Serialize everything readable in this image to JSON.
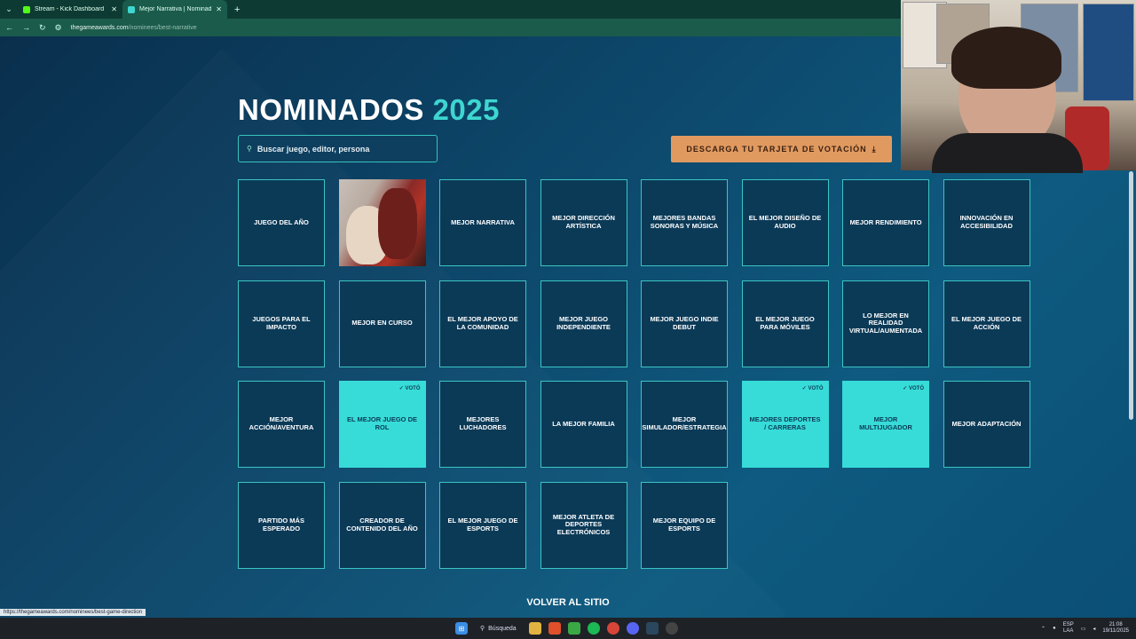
{
  "browser": {
    "tabs": [
      {
        "title": "Stream - Kick Dashboard",
        "favicon_color": "#53fc18",
        "active": false
      },
      {
        "title": "Mejor Narrativa | Nominados |",
        "favicon_color": "#3ed6d0",
        "active": true
      }
    ],
    "url_host": "thegameawards.com",
    "url_path": "/nominees/best-narrative"
  },
  "page": {
    "heading_main": "NOMINADOS",
    "heading_year": "2025",
    "search_placeholder": "Buscar juego, editor, persona",
    "download_label": "DESCARGA TU TARJETA DE VOTACIÓN",
    "back_label": "VOLVER AL SITIO",
    "status_url": "https://thegameawards.com/nominees/best-game-direction",
    "voted_label": "✓ VOTÓ",
    "accent_color": "#3ed6d0",
    "button_color": "#e09a60"
  },
  "categories": [
    {
      "label": "JUEGO DEL AÑO",
      "voted": false
    },
    {
      "label": "",
      "voted": false,
      "image": true
    },
    {
      "label": "MEJOR NARRATIVA",
      "voted": false
    },
    {
      "label": "MEJOR DIRECCIÓN ARTÍSTICA",
      "voted": false
    },
    {
      "label": "MEJORES BANDAS SONORAS Y MÚSICA",
      "voted": false
    },
    {
      "label": "EL MEJOR DISEÑO DE AUDIO",
      "voted": false
    },
    {
      "label": "MEJOR RENDIMIENTO",
      "voted": false
    },
    {
      "label": "INNOVACIÓN EN ACCESIBILIDAD",
      "voted": false
    },
    {
      "label": "JUEGOS PARA EL IMPACTO",
      "voted": false
    },
    {
      "label": "MEJOR EN CURSO",
      "voted": false
    },
    {
      "label": "EL MEJOR APOYO DE LA COMUNIDAD",
      "voted": false
    },
    {
      "label": "MEJOR JUEGO INDEPENDIENTE",
      "voted": false
    },
    {
      "label": "MEJOR JUEGO INDIE DEBUT",
      "voted": false
    },
    {
      "label": "EL MEJOR JUEGO PARA MÓVILES",
      "voted": false
    },
    {
      "label": "LO MEJOR EN REALIDAD VIRTUAL/AUMENTADA",
      "voted": false
    },
    {
      "label": "EL MEJOR JUEGO DE ACCIÓN",
      "voted": false
    },
    {
      "label": "MEJOR ACCIÓN/AVENTURA",
      "voted": false
    },
    {
      "label": "EL MEJOR JUEGO DE ROL",
      "voted": true
    },
    {
      "label": "MEJORES LUCHADORES",
      "voted": false
    },
    {
      "label": "LA MEJOR FAMILIA",
      "voted": false
    },
    {
      "label": "MEJOR SIMULADOR/ESTRATEGIA",
      "voted": false
    },
    {
      "label": "MEJORES DEPORTES / CARRERAS",
      "voted": true
    },
    {
      "label": "MEJOR MULTIJUGADOR",
      "voted": true
    },
    {
      "label": "MEJOR ADAPTACIÓN",
      "voted": false
    },
    {
      "label": "PARTIDO MÁS ESPERADO",
      "voted": false
    },
    {
      "label": "CREADOR DE CONTENIDO DEL AÑO",
      "voted": false
    },
    {
      "label": "EL MEJOR JUEGO DE ESPORTS",
      "voted": false
    },
    {
      "label": "MEJOR ATLETA DE DEPORTES ELECTRÓNICOS",
      "voted": false
    },
    {
      "label": "MEJOR EQUIPO DE ESPORTS",
      "voted": false
    }
  ],
  "taskbar": {
    "search_label": "Búsqueda",
    "lang_top": "ESP",
    "lang_bottom": "LAA",
    "time": "21:08",
    "date": "19/11/2025"
  }
}
